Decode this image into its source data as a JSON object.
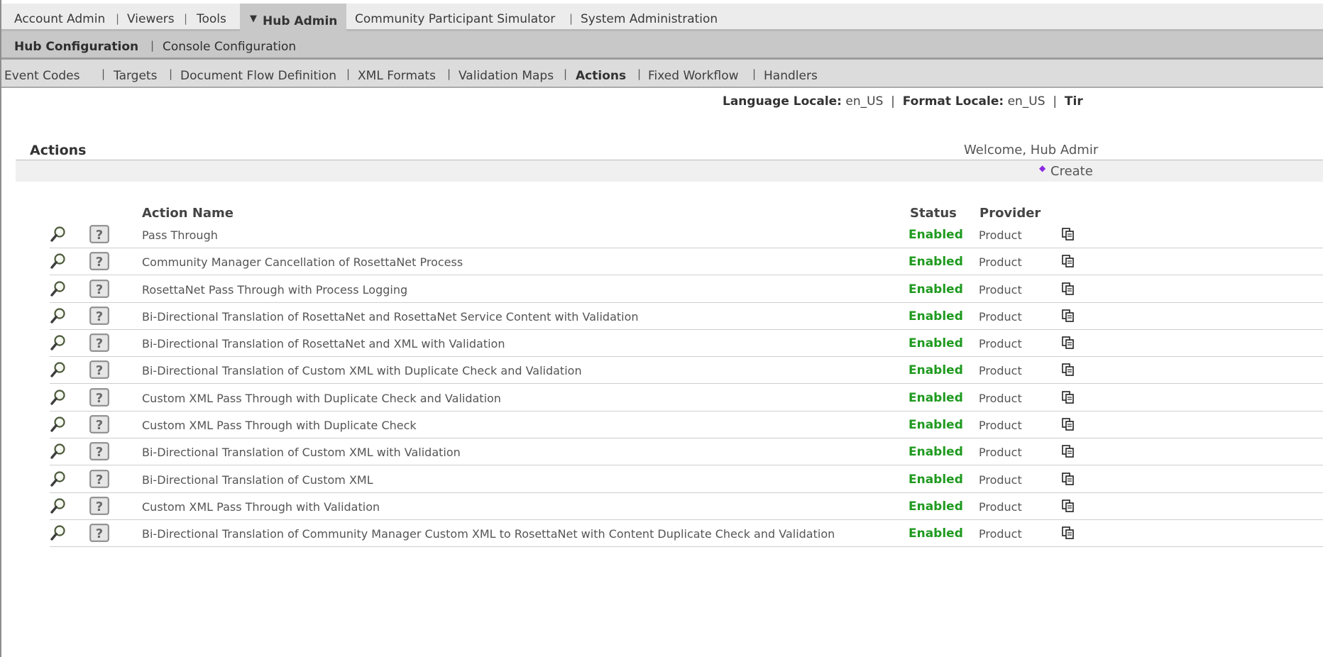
{
  "nav": {
    "top_items": [
      "Account Admin",
      "Viewers",
      "Tools"
    ],
    "active": "Hub Admin",
    "top_items_after": [
      "Community Participant Simulator",
      "System Administration"
    ],
    "second": {
      "active": "Hub Configuration",
      "other": "Console Configuration"
    },
    "third": {
      "items": [
        "Event Codes",
        "Targets",
        "Document Flow Definition",
        "XML Formats",
        "Validation Maps",
        "Actions",
        "Fixed Workflow",
        "Handlers"
      ],
      "active": "Actions"
    }
  },
  "locale": {
    "language_label": "Language Locale:",
    "language_value": "en_US",
    "format_label": "Format Locale:",
    "format_value": "en_US",
    "tz_label": "Tir"
  },
  "page": {
    "title": "Actions",
    "welcome": "Welcome, Hub Admir",
    "create": "Create"
  },
  "table": {
    "headers": {
      "name": "Action Name",
      "status": "Status",
      "provider": "Provider"
    },
    "rows": [
      {
        "name": "Pass Through",
        "status": "Enabled",
        "provider": "Product"
      },
      {
        "name": "Community Manager Cancellation of RosettaNet Process",
        "status": "Enabled",
        "provider": "Product"
      },
      {
        "name": "RosettaNet Pass Through with Process Logging",
        "status": "Enabled",
        "provider": "Product"
      },
      {
        "name": "Bi-Directional Translation of RosettaNet and RosettaNet Service Content with Validation",
        "status": "Enabled",
        "provider": "Product"
      },
      {
        "name": "Bi-Directional Translation of RosettaNet and XML with Validation",
        "status": "Enabled",
        "provider": "Product"
      },
      {
        "name": "Bi-Directional Translation of Custom XML with Duplicate Check and Validation",
        "status": "Enabled",
        "provider": "Product"
      },
      {
        "name": "Custom XML Pass Through with Duplicate Check and Validation",
        "status": "Enabled",
        "provider": "Product"
      },
      {
        "name": "Custom XML Pass Through with Duplicate Check",
        "status": "Enabled",
        "provider": "Product"
      },
      {
        "name": "Bi-Directional Translation of Custom XML with Validation",
        "status": "Enabled",
        "provider": "Product"
      },
      {
        "name": "Bi-Directional Translation of Custom XML",
        "status": "Enabled",
        "provider": "Product"
      },
      {
        "name": "Custom XML Pass Through with Validation",
        "status": "Enabled",
        "provider": "Product"
      },
      {
        "name": "Bi-Directional Translation of Community Manager Custom XML to RosettaNet with Content Duplicate Check and Validation",
        "status": "Enabled",
        "provider": "Product"
      }
    ]
  },
  "icons": {
    "view": "magnifier-icon",
    "help": "help-icon",
    "copy": "copy-icon"
  },
  "colors": {
    "enabled": "#1f9a1f",
    "nav_top": "#ececec",
    "nav_active": "#c8c8c8",
    "nav_third": "#dcdcdc"
  }
}
